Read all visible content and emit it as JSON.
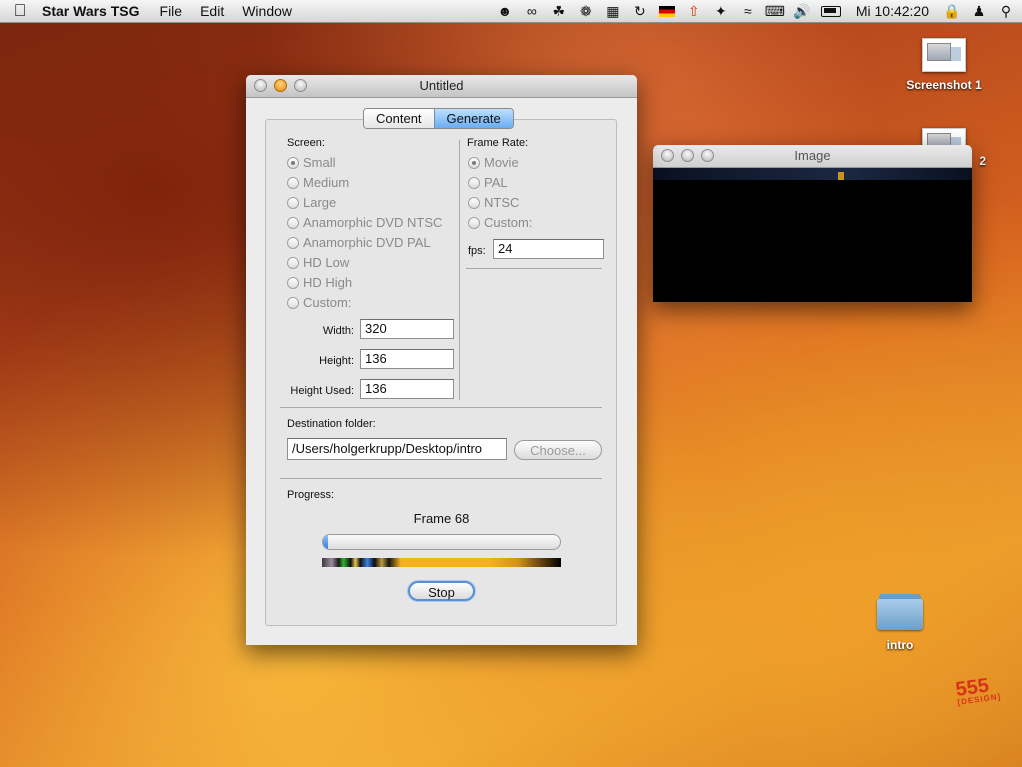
{
  "menubar": {
    "app_name": "Star Wars TSG",
    "items": [
      "File",
      "Edit",
      "Window"
    ],
    "clock": "Mi 10:42:20"
  },
  "desktop": {
    "screenshot1_label": "Screenshot 1",
    "screenshot2_label": "2",
    "folder_label": "intro",
    "logo_text": "555",
    "logo_sub": "[DESIGN]"
  },
  "main_window": {
    "title": "Untitled",
    "tabs": [
      "Content",
      "Generate"
    ],
    "active_tab": "Generate",
    "screen_label": "Screen:",
    "screen_options": [
      "Small",
      "Medium",
      "Large",
      "Anamorphic DVD NTSC",
      "Anamorphic DVD PAL",
      "HD Low",
      "HD High",
      "Custom:"
    ],
    "screen_selected": "Small",
    "width_label": "Width:",
    "width_value": "320",
    "height_label": "Height:",
    "height_value": "136",
    "height_used_label": "Height Used:",
    "height_used_value": "136",
    "frame_rate_label": "Frame Rate:",
    "frame_rate_options": [
      "Movie",
      "PAL",
      "NTSC",
      "Custom:"
    ],
    "frame_rate_selected": "Movie",
    "fps_label": "fps:",
    "fps_value": "24",
    "destination_label": "Destination folder:",
    "destination_value": "/Users/holgerkrupp/Desktop/intro",
    "choose_button": "Choose...",
    "progress_label": "Progress:",
    "frame_text": "Frame 68",
    "progress_fraction": 0.02,
    "stop_button": "Stop"
  },
  "image_window": {
    "title": "Image"
  }
}
